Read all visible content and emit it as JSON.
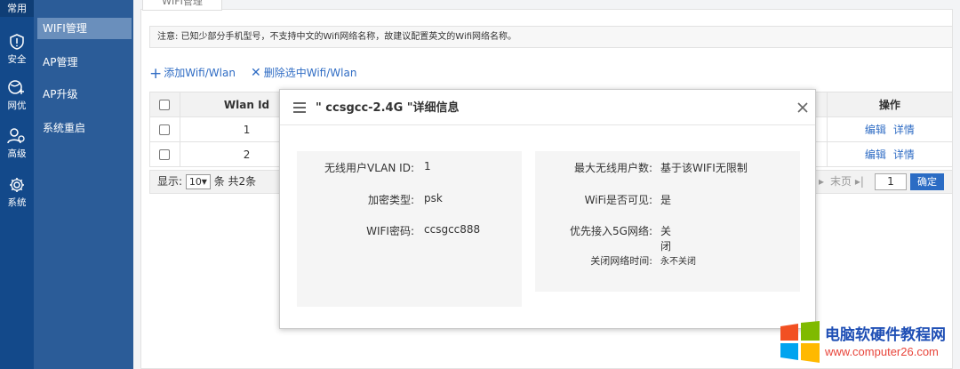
{
  "rail": {
    "top": "常用",
    "items": [
      {
        "name": "security",
        "label": "安全"
      },
      {
        "name": "network",
        "label": "网优"
      },
      {
        "name": "advanced",
        "label": "高级"
      },
      {
        "name": "system",
        "label": "系统"
      }
    ]
  },
  "menu": {
    "items": [
      "WIFI管理",
      "AP管理",
      "AP升级",
      "系统重启"
    ]
  },
  "tab": {
    "label": "WIFI管理"
  },
  "notice": "注意: 已知少部分手机型号，不支持中文的Wifi网络名称，故建议配置英文的Wifi网络名称。",
  "actions": {
    "add": "添加Wifi/Wlan",
    "delete": "删除选中Wifi/Wlan"
  },
  "table": {
    "headers": {
      "wlan_id": "Wlan Id",
      "ops": "操作"
    },
    "rows": [
      {
        "id": "1",
        "edit": "编辑",
        "detail": "详情"
      },
      {
        "id": "2",
        "edit": "编辑",
        "detail": "详情"
      }
    ]
  },
  "pager": {
    "show": "显示:",
    "size": "10",
    "count": "条 共2条",
    "last": "末页",
    "page": "1",
    "confirm": "确定"
  },
  "modal": {
    "title": "\" ccsgcc-2.4G \"详细信息",
    "left": [
      {
        "label": "无线用户VLAN ID:",
        "value": "1"
      },
      {
        "label": "加密类型:",
        "value": "psk"
      },
      {
        "label": "WIFI密码:",
        "value": "ccsgcc888"
      }
    ],
    "right": [
      {
        "label": "最大无线用户数:",
        "value": "基于该WIFI无限制"
      },
      {
        "label": "WiFi是否可见:",
        "value": "是"
      },
      {
        "label": "优先接入5G网络:",
        "value": "关闭"
      },
      {
        "label": "关闭网络时间:",
        "value": "永不关闭"
      }
    ]
  },
  "watermark": {
    "title": "电脑软硬件教程网",
    "url": "www.computer26.com"
  },
  "colors": {
    "rail": "#13498a",
    "menu": "#2b5c98",
    "link": "#2f6cc4",
    "button": "#2b6cc4"
  }
}
